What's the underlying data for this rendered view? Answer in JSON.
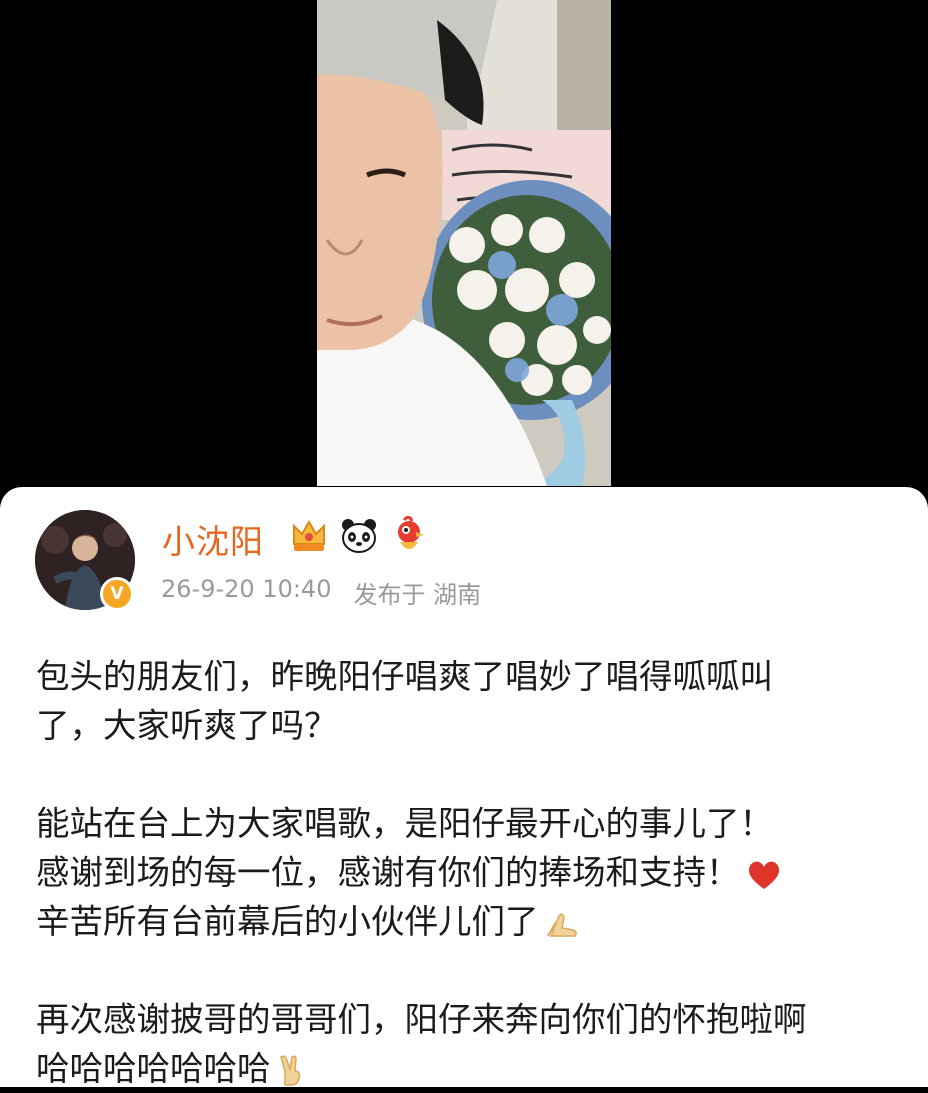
{
  "post": {
    "author": {
      "name": "小沈阳",
      "verified_mark": "V",
      "badges": [
        "crown-badge-icon",
        "panda-badge-icon",
        "mascot-badge-icon"
      ]
    },
    "timestamp": "26-9-20 10:40",
    "location": "发布于 湖南",
    "paragraphs": [
      [
        "包头的朋友们，昨晚阳仔唱爽了唱妙了唱得呱呱叫",
        "了，大家听爽了吗？"
      ],
      [
        "能站在台上为大家唱歌，是阳仔最开心的事儿了！",
        "感谢到场的每一位，感谢有你们的捧场和支持！",
        "辛苦所有台前幕后的小伙伴儿们了"
      ],
      [
        "再次感谢披哥的哥哥们，阳仔来奔向你们的怀抱啦啊",
        "哈哈哈哈哈哈哈"
      ]
    ],
    "emojis": [
      "heart-icon",
      "pray-hands-icon",
      "victory-hand-icon"
    ]
  },
  "colors": {
    "username": "#e8651d",
    "meta_text": "#9a9a9a",
    "body_text": "#1b1b1b",
    "verified": "#f5a623",
    "heart": "#e0342b"
  }
}
